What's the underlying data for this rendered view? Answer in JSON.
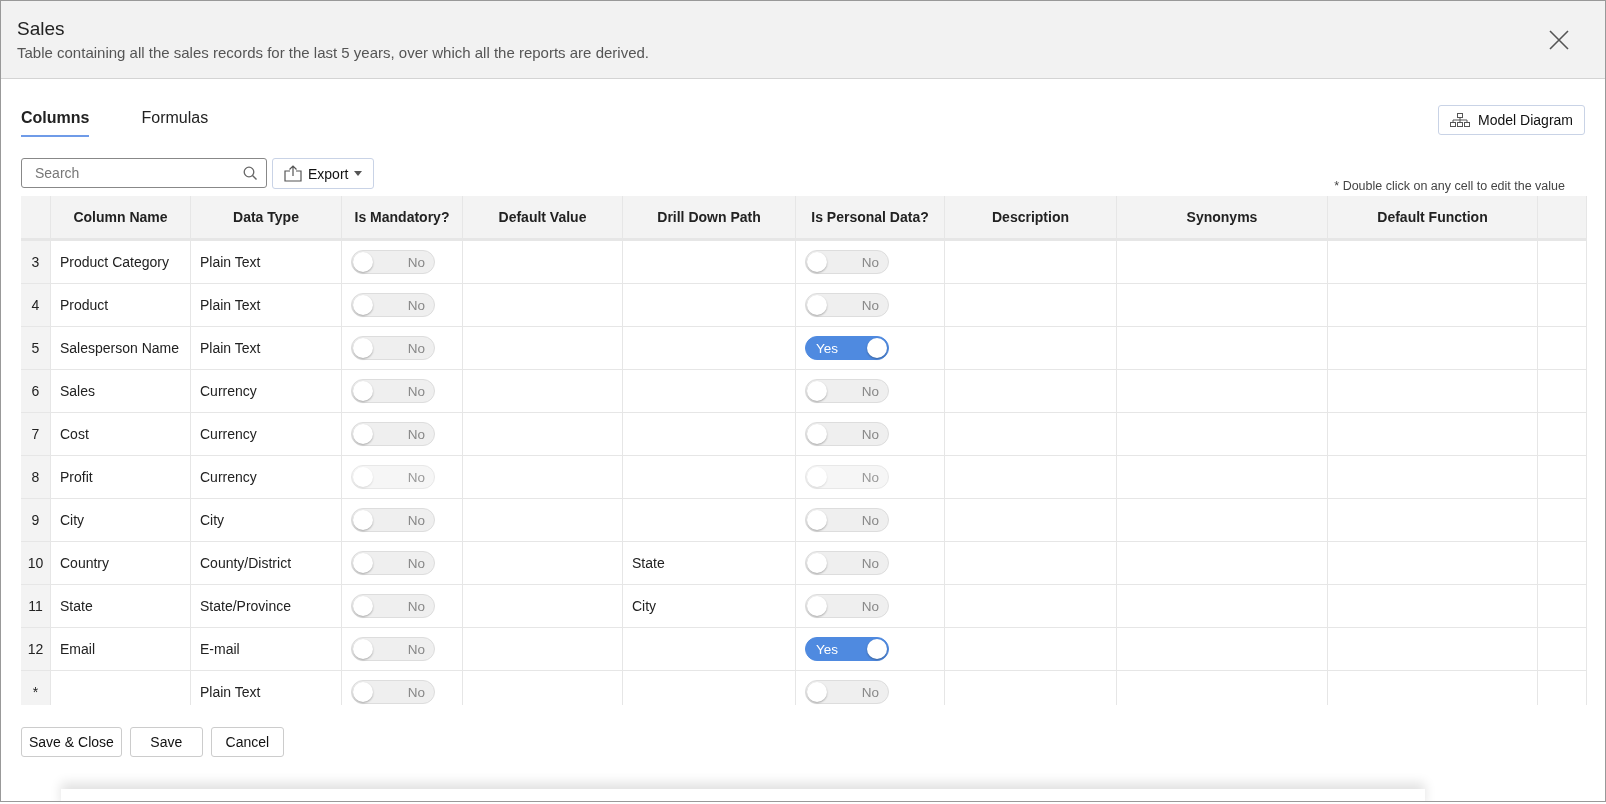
{
  "dialog": {
    "title": "Sales",
    "subtitle": "Table containing all the sales records for the last 5 years, over which all the reports are derived."
  },
  "tabs": [
    {
      "label": "Columns",
      "selected": true
    },
    {
      "label": "Formulas",
      "selected": false
    }
  ],
  "model_diagram_button": "Model Diagram",
  "search": {
    "placeholder": "Search"
  },
  "export_button": "Export",
  "hint": "* Double click on any cell to edit the value",
  "table": {
    "columns": [
      "Column Name",
      "Data Type",
      "Is Mandatory?",
      "Default Value",
      "Drill Down Path",
      "Is Personal Data?",
      "Description",
      "Synonyms",
      "Default Function"
    ],
    "rows": [
      {
        "index": "3",
        "name": "Product Category",
        "data_type": "Plain Text",
        "mandatory": {
          "label": "No",
          "on": false,
          "disabled": false
        },
        "personal": {
          "label": "No",
          "on": false,
          "disabled": false
        }
      },
      {
        "index": "4",
        "name": "Product",
        "data_type": "Plain Text",
        "mandatory": {
          "label": "No",
          "on": false,
          "disabled": false
        },
        "personal": {
          "label": "No",
          "on": false,
          "disabled": false
        }
      },
      {
        "index": "5",
        "name": "Salesperson Name",
        "data_type": "Plain Text",
        "mandatory": {
          "label": "No",
          "on": false,
          "disabled": false
        },
        "personal": {
          "label": "Yes",
          "on": true,
          "disabled": false
        }
      },
      {
        "index": "6",
        "name": "Sales",
        "data_type": "Currency",
        "mandatory": {
          "label": "No",
          "on": false,
          "disabled": false
        },
        "personal": {
          "label": "No",
          "on": false,
          "disabled": false
        }
      },
      {
        "index": "7",
        "name": "Cost",
        "data_type": "Currency",
        "mandatory": {
          "label": "No",
          "on": false,
          "disabled": false
        },
        "personal": {
          "label": "No",
          "on": false,
          "disabled": false
        }
      },
      {
        "index": "8",
        "name": "Profit",
        "data_type": "Currency",
        "mandatory": {
          "label": "No",
          "on": false,
          "disabled": true
        },
        "personal": {
          "label": "No",
          "on": false,
          "disabled": true
        }
      },
      {
        "index": "9",
        "name": "City",
        "data_type": "City",
        "mandatory": {
          "label": "No",
          "on": false,
          "disabled": false
        },
        "personal": {
          "label": "No",
          "on": false,
          "disabled": false
        }
      },
      {
        "index": "10",
        "name": "Country",
        "data_type": "County/District",
        "drill_down_path": "State",
        "mandatory": {
          "label": "No",
          "on": false,
          "disabled": false
        },
        "personal": {
          "label": "No",
          "on": false,
          "disabled": false
        }
      },
      {
        "index": "11",
        "name": "State",
        "data_type": "State/Province",
        "drill_down_path": "City",
        "mandatory": {
          "label": "No",
          "on": false,
          "disabled": false
        },
        "personal": {
          "label": "No",
          "on": false,
          "disabled": false
        }
      },
      {
        "index": "12",
        "name": "Email",
        "data_type": "E-mail",
        "mandatory": {
          "label": "No",
          "on": false,
          "disabled": false
        },
        "personal": {
          "label": "Yes",
          "on": true,
          "disabled": false
        }
      },
      {
        "index": "*",
        "data_type": "Plain Text",
        "mandatory": {
          "label": "No",
          "on": false,
          "disabled": false
        },
        "personal": {
          "label": "No",
          "on": false,
          "disabled": false
        }
      }
    ]
  },
  "footer_buttons": [
    "Save & Close",
    "Save",
    "Cancel"
  ]
}
